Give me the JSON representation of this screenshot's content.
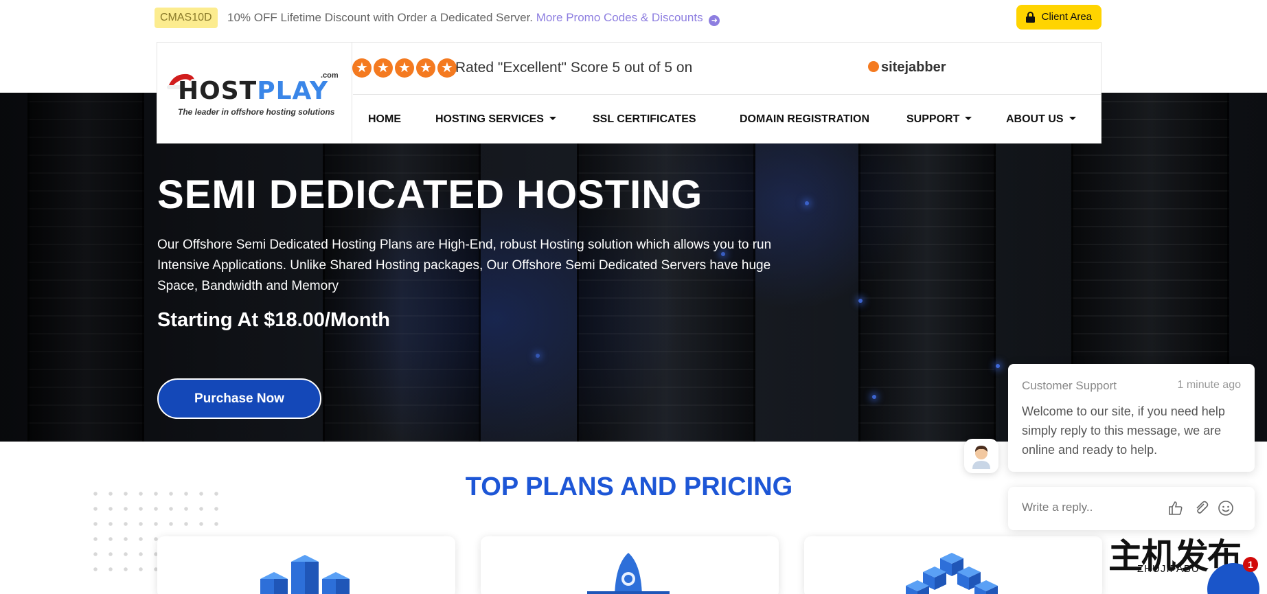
{
  "promo": {
    "code": "CMAS10D",
    "text": "10% OFF Lifetime Discount with Order a Dedicated Server.",
    "link": "More Promo Codes & Discounts"
  },
  "client_area": {
    "label": "Client Area"
  },
  "logo": {
    "name_part1": "OST",
    "name_part2": "PLAY",
    "domain": ".com",
    "tagline": "The leader in offshore hosting solutions"
  },
  "rating": {
    "text": "Rated \"Excellent\" Score 5 out of 5 on",
    "site": "sitejabber",
    "stars": 5
  },
  "nav": {
    "items": [
      {
        "label": "HOME"
      },
      {
        "label": "HOSTING SERVICES"
      },
      {
        "label": "SSL CERTIFICATES"
      },
      {
        "label": "DOMAIN REGISTRATION"
      },
      {
        "label": "SUPPORT"
      },
      {
        "label": "ABOUT US"
      }
    ]
  },
  "hero": {
    "title": "SEMI DEDICATED HOSTING",
    "description": "Our Offshore Semi Dedicated Hosting Plans are High-End, robust Hosting solution which allows you to run Intensive Applications. Unlike Shared Hosting packages, Our Offshore Semi Dedicated Servers have huge Space, Bandwidth and Memory",
    "price": "Starting At $18.00/Month",
    "cta": "Purchase Now"
  },
  "pricing": {
    "title": "TOP PLANS AND PRICING"
  },
  "chat": {
    "from": "Customer Support",
    "time": "1 minute ago",
    "message": "Welcome to our site, if you need help simply reply to this message, we are online and ready to help.",
    "reply_placeholder": "Write a reply..",
    "unread": "1"
  },
  "watermark": {
    "cn": "主机发布",
    "en": "ZHUJIFABU"
  },
  "colors": {
    "accent_blue": "#1d56d6",
    "button_blue": "#1448b8",
    "client_yellow": "#ffd400",
    "star_orange": "#f47a20",
    "promo_link": "#8d7ee0"
  }
}
